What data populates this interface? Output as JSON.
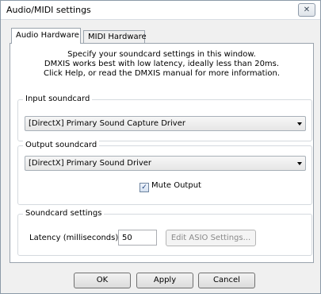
{
  "window": {
    "title": "Audio/MIDI settings",
    "close_icon": "close-icon"
  },
  "tabs": [
    {
      "label": "Audio Hardware",
      "active": true
    },
    {
      "label": "MIDI Hardware",
      "active": false
    }
  ],
  "intro": {
    "line1": "Specify your soundcard settings in this window.",
    "line2": "DMXIS works best with low latency, ideally less than 20ms.",
    "line3": "Click Help, or read the DMXIS manual for more information."
  },
  "input": {
    "legend": "Input soundcard",
    "selected": "[DirectX] Primary Sound Capture Driver"
  },
  "output": {
    "legend": "Output soundcard",
    "selected": "[DirectX] Primary Sound Driver",
    "mute_label": "Mute Output",
    "mute_checked": true,
    "check_mark": "✓"
  },
  "soundcard": {
    "legend": "Soundcard settings",
    "latency_label": "Latency (milliseconds):",
    "latency_value": "50",
    "asio_button": "Edit ASIO Settings..."
  },
  "buttons": {
    "ok": "OK",
    "apply": "Apply",
    "cancel": "Cancel"
  }
}
